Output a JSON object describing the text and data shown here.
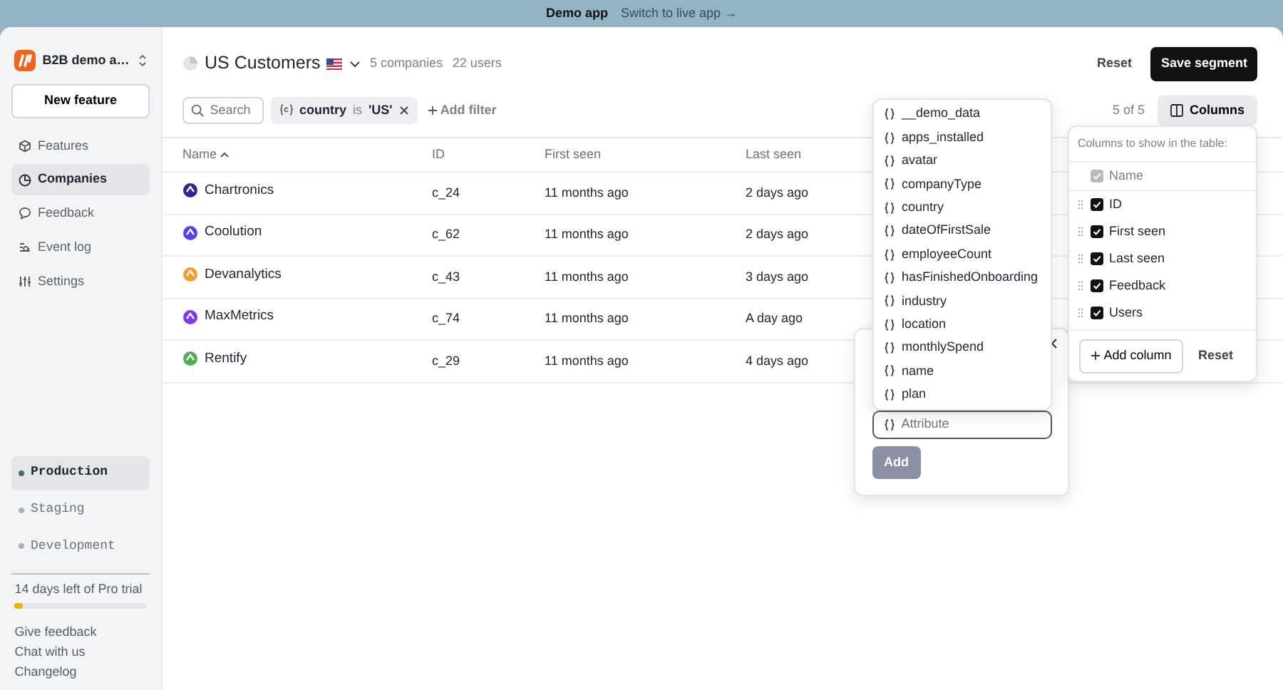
{
  "banner": {
    "title": "Demo app",
    "link": "Switch to live app →"
  },
  "sidebar": {
    "app_name": "B2B demo a…",
    "new_button": "New feature",
    "nav": [
      {
        "label": "Features",
        "kind": "cube",
        "selected": false
      },
      {
        "label": "Companies",
        "kind": "pie",
        "selected": true
      },
      {
        "label": "Feedback",
        "kind": "bubble",
        "selected": false
      },
      {
        "label": "Event log",
        "kind": "log",
        "selected": false
      },
      {
        "label": "Settings",
        "kind": "sliders",
        "selected": false
      }
    ],
    "environments": [
      {
        "label": "Production",
        "selected": true
      },
      {
        "label": "Staging",
        "selected": false
      },
      {
        "label": "Development",
        "selected": false
      }
    ],
    "trial": {
      "text": "14 days left of Pro trial",
      "level": 0.06
    },
    "links": [
      "Give feedback",
      "Chat with us",
      "Changelog"
    ]
  },
  "header": {
    "title": "US Customers",
    "companies": "5 companies",
    "users": "22 users",
    "reset": "Reset",
    "save": "Save segment"
  },
  "filters": {
    "search": {
      "placeholder": "Search"
    },
    "chip": {
      "field": "country",
      "operator": "is",
      "value": "'US'"
    },
    "add_filter": "Add filter",
    "count": "5 of 5",
    "columns_button": "Columns"
  },
  "table": {
    "columns": [
      {
        "label": "Name",
        "sorted": true
      },
      {
        "label": "ID",
        "sorted": false
      },
      {
        "label": "First seen",
        "sorted": false
      },
      {
        "label": "Last seen",
        "sorted": false
      }
    ],
    "rows": [
      {
        "name": "Chartronics",
        "id": "c_24",
        "first_seen": "11 months ago",
        "last_seen": "2 days ago",
        "color": "#3b1d8f"
      },
      {
        "name": "Coolution",
        "id": "c_62",
        "first_seen": "11 months ago",
        "last_seen": "2 days ago",
        "color": "#4f46e5"
      },
      {
        "name": "Devanalytics",
        "id": "c_43",
        "first_seen": "11 months ago",
        "last_seen": "3 days ago",
        "color": "#f0a030"
      },
      {
        "name": "MaxMetrics",
        "id": "c_74",
        "first_seen": "11 months ago",
        "last_seen": "A day ago",
        "color": "#7c3aed"
      },
      {
        "name": "Rentify",
        "id": "c_29",
        "first_seen": "11 months ago",
        "last_seen": "4 days ago",
        "color": "#4caf50"
      }
    ]
  },
  "columns_popover": {
    "title": "Columns to show in the table:",
    "items": [
      {
        "label": "Name",
        "checked": true,
        "disabled": true
      },
      {
        "label": "ID",
        "checked": true,
        "disabled": false
      },
      {
        "label": "First seen",
        "checked": true,
        "disabled": false
      },
      {
        "label": "Last seen",
        "checked": true,
        "disabled": false
      },
      {
        "label": "Feedback",
        "checked": true,
        "disabled": false
      },
      {
        "label": "Users",
        "checked": true,
        "disabled": false
      }
    ],
    "add_column": "Add column",
    "reset": "Reset"
  },
  "attribute_popover": {
    "options": [
      "__demo_data",
      "apps_installed",
      "avatar",
      "companyType",
      "country",
      "dateOfFirstSale",
      "employeeCount",
      "hasFinishedOnboarding",
      "industry",
      "location",
      "monthlySpend",
      "name",
      "plan"
    ],
    "input": {
      "placeholder": "Attribute"
    },
    "add_button": {
      "label": "Add",
      "disabled": true
    }
  }
}
